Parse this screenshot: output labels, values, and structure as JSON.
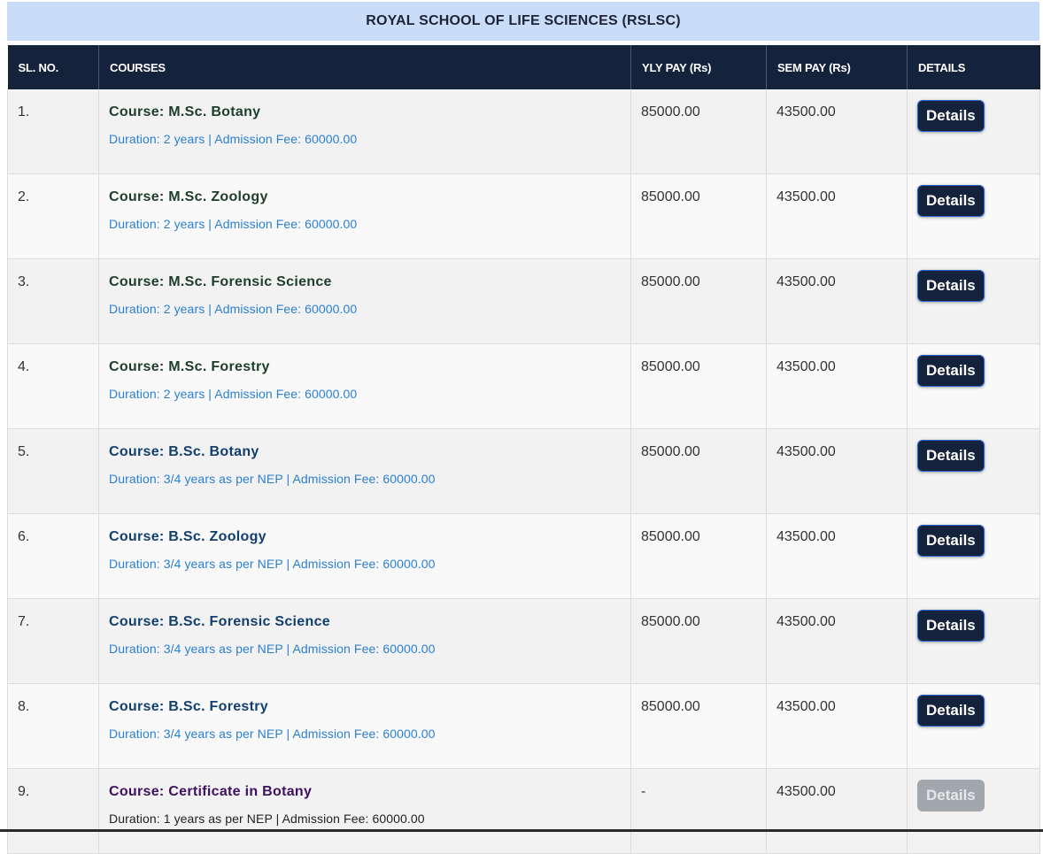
{
  "title": "ROYAL SCHOOL OF LIFE SCIENCES (RSLSC)",
  "headers": {
    "sl": "SL. NO.",
    "courses": "COURSES",
    "yly": "YLY PAY (Rs)",
    "sem": "SEM PAY (Rs)",
    "details": "DETAILS"
  },
  "rows": [
    {
      "sl": "1.",
      "course": "Course: M.Sc. Botany",
      "sub": "Duration: 2 years | Admission Fee: 60000.00",
      "yly": "85000.00",
      "sem": "43500.00",
      "btn": "Details"
    },
    {
      "sl": "2.",
      "course": "Course: M.Sc. Zoology",
      "sub": "Duration: 2 years | Admission Fee: 60000.00",
      "yly": "85000.00",
      "sem": "43500.00",
      "btn": "Details"
    },
    {
      "sl": "3.",
      "course": "Course: M.Sc. Forensic Science",
      "sub": "Duration: 2 years | Admission Fee: 60000.00",
      "yly": "85000.00",
      "sem": "43500.00",
      "btn": "Details"
    },
    {
      "sl": "4.",
      "course": "Course: M.Sc. Forestry",
      "sub": "Duration: 2 years | Admission Fee: 60000.00",
      "yly": "85000.00",
      "sem": "43500.00",
      "btn": "Details"
    },
    {
      "sl": "5.",
      "course": "Course: B.Sc. Botany",
      "sub": "Duration: 3/4 years as per NEP | Admission Fee: 60000.00",
      "yly": "85000.00",
      "sem": "43500.00",
      "btn": "Details"
    },
    {
      "sl": "6.",
      "course": "Course: B.Sc. Zoology",
      "sub": "Duration: 3/4 years as per NEP | Admission Fee: 60000.00",
      "yly": "85000.00",
      "sem": "43500.00",
      "btn": "Details"
    },
    {
      "sl": "7.",
      "course": "Course: B.Sc. Forensic Science",
      "sub": "Duration: 3/4 years as per NEP | Admission Fee: 60000.00",
      "yly": "85000.00",
      "sem": "43500.00",
      "btn": "Details"
    },
    {
      "sl": "8.",
      "course": "Course: B.Sc. Forestry",
      "sub": "Duration: 3/4 years as per NEP | Admission Fee: 60000.00",
      "yly": "85000.00",
      "sem": "43500.00",
      "btn": "Details"
    },
    {
      "sl": "9.",
      "course": "Course: Certificate in Botany",
      "sub": "Duration: 1 years as per NEP | Admission Fee: 60000.00",
      "yly": "-",
      "sem": "43500.00",
      "btn": "Details"
    }
  ],
  "colors": {
    "title_bg": "#c9dcf8",
    "header_bg": "#14223c",
    "button_bg": "#14223c",
    "button_disabled_bg": "#a2a6ad",
    "msc_course": "#1e3d2a",
    "bsc_course": "#123f6e",
    "cert_course": "#3d1160",
    "sub_link": "#2b7fd1"
  }
}
